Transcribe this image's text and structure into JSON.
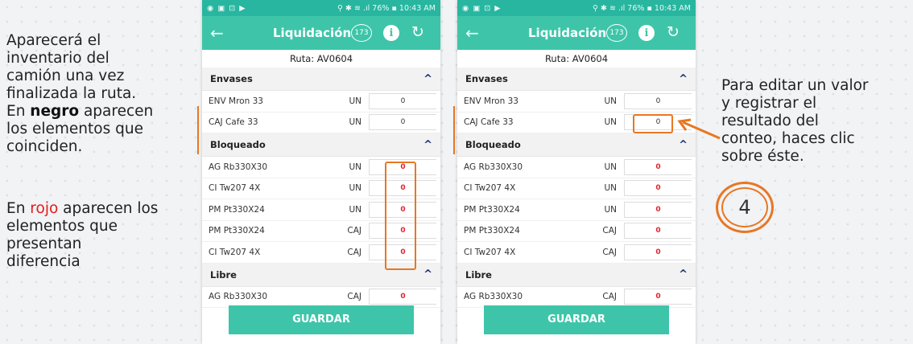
{
  "left_panel": {
    "intro": [
      "Aparecerá el",
      "inventario del",
      "camión una vez",
      "finalizada la ruta.",
      "En ",
      "negro",
      " aparecen",
      "los elementos que",
      "coinciden."
    ],
    "rojo": [
      "En ",
      "rojo",
      " aparecen los",
      "elementos que",
      "presentan",
      "diferencia"
    ]
  },
  "right_panel": {
    "lines": [
      "Para editar un valor",
      "y registrar el",
      "resultado del",
      "conteo, haces clic",
      "sobre éste."
    ],
    "step_number": "4"
  },
  "colors": {
    "accent": "#e87722",
    "toolbar": "#3ec5a9",
    "statusbar": "#28b6a0",
    "diff": "#e0242f"
  },
  "phone1": {
    "status_left": "◉ ▣ ⊡ ▶",
    "status_right": "⚲ ✱ ≋ .ıl 76% ▪ 10:43 AM",
    "title": "Liquidación",
    "badge": "173",
    "back_icon": "←",
    "info_icon": "i",
    "refresh_icon": "↻",
    "ruta": "Ruta: AV0604",
    "sections": [
      {
        "header": "Envases",
        "chevron": "^",
        "items": [
          {
            "name": "ENV Mron 33",
            "unit": "UN",
            "value": "0",
            "diff": false
          },
          {
            "name": "CAJ Cafe 33",
            "unit": "UN",
            "value": "0",
            "diff": false
          }
        ]
      },
      {
        "header": "Bloqueado",
        "chevron": "^",
        "items": [
          {
            "name": "AG Rb330X30",
            "unit": "UN",
            "value": "0",
            "diff": true
          },
          {
            "name": "CI Tw207 4X",
            "unit": "UN",
            "value": "0",
            "diff": true
          },
          {
            "name": "PM Pt330X24",
            "unit": "UN",
            "value": "0",
            "diff": true
          },
          {
            "name": "PM Pt330X24",
            "unit": "CAJ",
            "value": "0",
            "diff": true
          },
          {
            "name": "CI Tw207 4X",
            "unit": "CAJ",
            "value": "0",
            "diff": true
          }
        ]
      },
      {
        "header": "Libre",
        "chevron": "^",
        "items": [
          {
            "name": "AG Rb330X30",
            "unit": "CAJ",
            "value": "0",
            "diff": true
          }
        ]
      }
    ],
    "save_label": "GUARDAR"
  },
  "phone2": {
    "status_left": "◉ ▣ ⊡ ▶",
    "status_right": "⚲ ✱ ≋ .ıl 76% ▪ 10:43 AM",
    "title": "Liquidación",
    "badge": "173",
    "back_icon": "←",
    "info_icon": "i",
    "refresh_icon": "↻",
    "ruta": "Ruta: AV0604",
    "sections": [
      {
        "header": "Envases",
        "chevron": "^",
        "items": [
          {
            "name": "ENV Mron 33",
            "unit": "UN",
            "value": "0",
            "diff": false
          },
          {
            "name": "CAJ Cafe 33",
            "unit": "UN",
            "value": "0",
            "diff": false
          }
        ]
      },
      {
        "header": "Bloqueado",
        "chevron": "^",
        "items": [
          {
            "name": "AG Rb330X30",
            "unit": "UN",
            "value": "0",
            "diff": true
          },
          {
            "name": "CI Tw207 4X",
            "unit": "UN",
            "value": "0",
            "diff": true
          },
          {
            "name": "PM Pt330X24",
            "unit": "UN",
            "value": "0",
            "diff": true
          },
          {
            "name": "PM Pt330X24",
            "unit": "CAJ",
            "value": "0",
            "diff": true
          },
          {
            "name": "CI Tw207 4X",
            "unit": "CAJ",
            "value": "0",
            "diff": true
          }
        ]
      },
      {
        "header": "Libre",
        "chevron": "^",
        "items": [
          {
            "name": "AG Rb330X30",
            "unit": "CAJ",
            "value": "0",
            "diff": true
          }
        ]
      }
    ],
    "save_label": "GUARDAR"
  }
}
